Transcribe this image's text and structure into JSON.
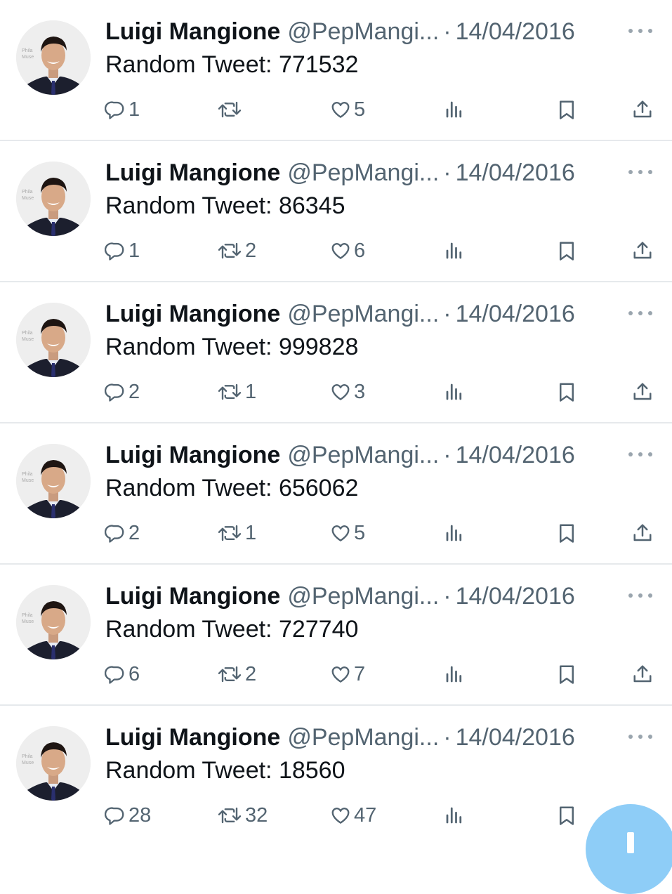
{
  "colors": {
    "text_primary": "#0f1419",
    "text_secondary": "#536471",
    "divider": "#e6e9ec",
    "fab": "#8ecdf7"
  },
  "tweets": [
    {
      "name": "Luigi Mangione",
      "handle": "@PepMangi...",
      "date": "14/04/2016",
      "text": "Random Tweet: 771532",
      "replies": "1",
      "retweets": "",
      "likes": "5"
    },
    {
      "name": "Luigi Mangione",
      "handle": "@PepMangi...",
      "date": "14/04/2016",
      "text": "Random Tweet: 86345",
      "replies": "1",
      "retweets": "2",
      "likes": "6"
    },
    {
      "name": "Luigi Mangione",
      "handle": "@PepMangi...",
      "date": "14/04/2016",
      "text": "Random Tweet: 999828",
      "replies": "2",
      "retweets": "1",
      "likes": "3"
    },
    {
      "name": "Luigi Mangione",
      "handle": "@PepMangi...",
      "date": "14/04/2016",
      "text": "Random Tweet: 656062",
      "replies": "2",
      "retweets": "1",
      "likes": "5"
    },
    {
      "name": "Luigi Mangione",
      "handle": "@PepMangi...",
      "date": "14/04/2016",
      "text": "Random Tweet: 727740",
      "replies": "6",
      "retweets": "2",
      "likes": "7"
    },
    {
      "name": "Luigi Mangione",
      "handle": "@PepMangi...",
      "date": "14/04/2016",
      "text": "Random Tweet: 18560",
      "replies": "28",
      "retweets": "32",
      "likes": "47"
    }
  ],
  "icons": {
    "reply": "reply-icon",
    "retweet": "retweet-icon",
    "like": "heart-icon",
    "views": "views-icon",
    "bookmark": "bookmark-icon",
    "share": "share-icon",
    "more": "more-icon",
    "compose": "compose-icon"
  }
}
